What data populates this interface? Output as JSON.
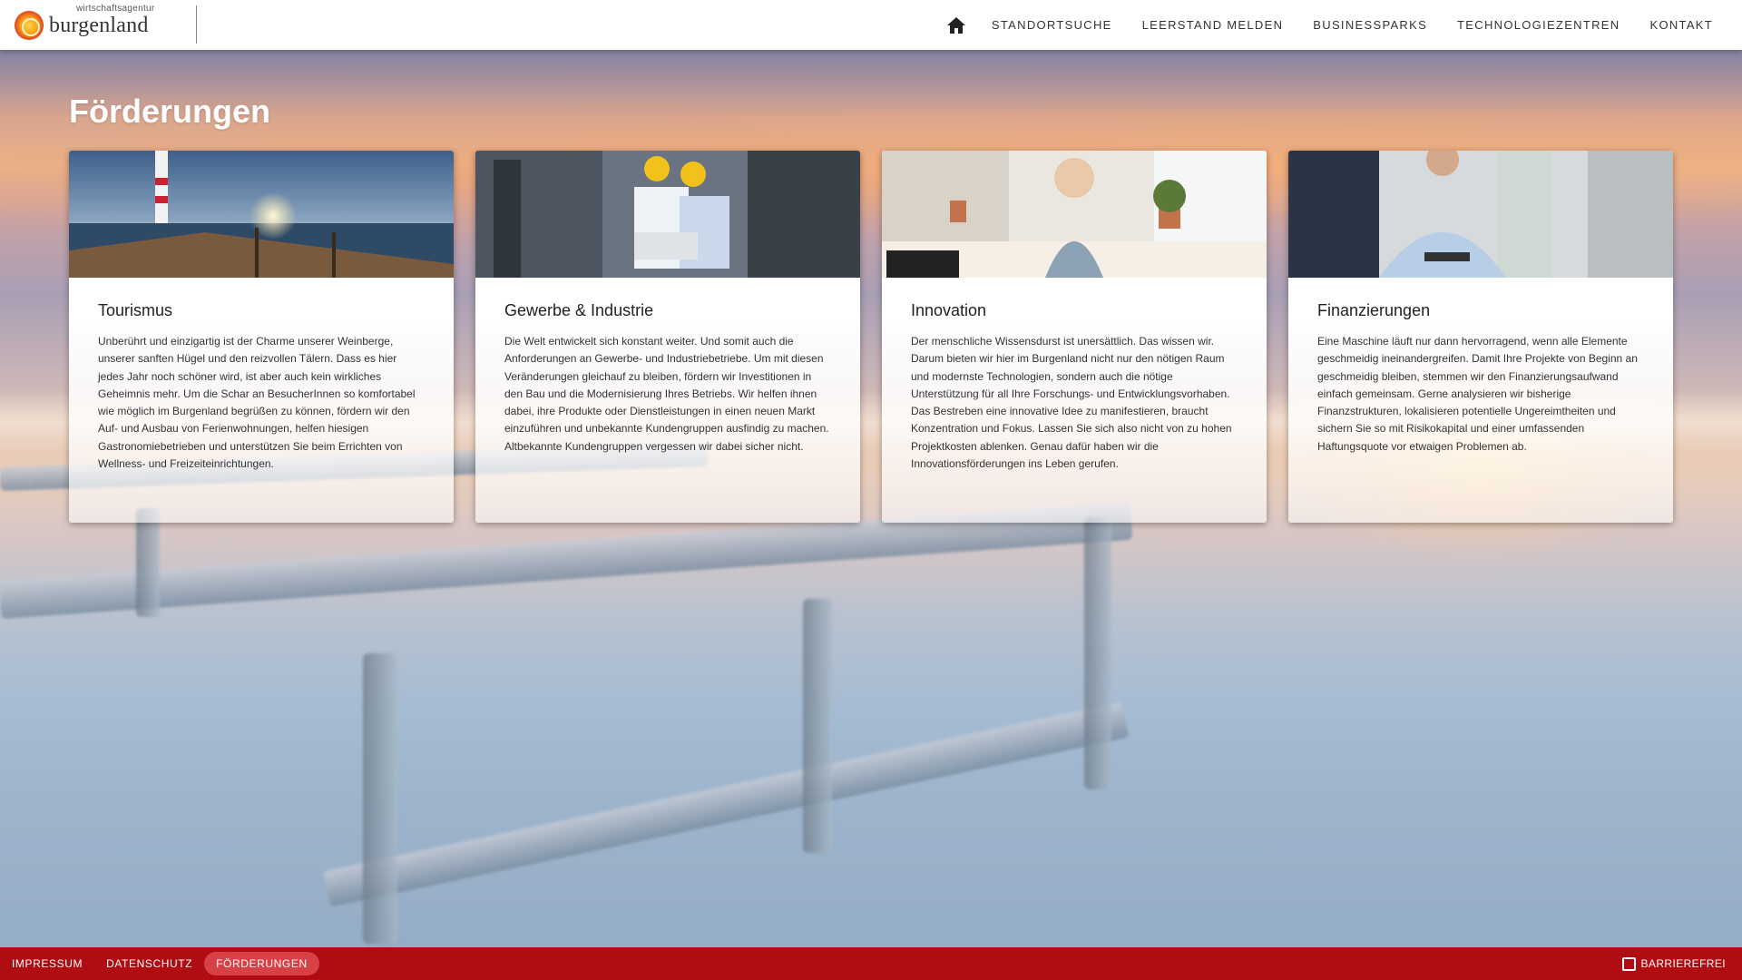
{
  "logo": {
    "small_text": "wirtschaftsagentur",
    "big_text": "burgenland"
  },
  "nav": {
    "home_icon": "home-icon",
    "items": [
      "STANDORTSUCHE",
      "LEERSTAND MELDEN",
      "BUSINESSPARKS",
      "TECHNOLOGIEZENTREN",
      "KONTAKT"
    ]
  },
  "page": {
    "title": "Förderungen"
  },
  "cards": [
    {
      "title": "Tourismus",
      "text": "Unberührt und einzigartig ist der Charme unserer Weinberge, unserer sanften Hügel und den reizvollen Tälern. Dass es hier jedes Jahr noch schöner wird, ist aber auch kein wirkliches Geheimnis mehr. Um die Schar an BesucherInnen so komfortabel wie möglich im Burgenland begrüßen zu können, fördern wir den Auf- und Ausbau von Ferienwohnungen, helfen hiesigen Gastronomiebetrieben und unterstützen Sie beim Errichten von Wellness- und Freizeiteinrichtungen."
    },
    {
      "title": "Gewerbe & Industrie",
      "text": "Die Welt entwickelt sich konstant weiter. Und somit auch die Anforderungen an Gewerbe- und Industriebetriebe. Um mit diesen Veränderungen gleichauf zu bleiben, fördern wir Investitionen in den Bau und die Modernisierung Ihres Betriebs. Wir helfen ihnen dabei, ihre Produkte oder Dienstleistungen in einen neuen Markt einzuführen und unbekannte Kundengruppen ausfindig zu machen. Altbekannte Kundengruppen vergessen wir dabei sicher nicht."
    },
    {
      "title": "Innovation",
      "text": "Der menschliche Wissensdurst ist unersättlich. Das wissen wir. Darum bieten wir hier im Burgenland nicht nur den nötigen Raum und modernste Technologien, sondern auch die nötige Unterstützung für all Ihre Forschungs- und Entwicklungsvorhaben. Das Bestreben eine innovative Idee zu manifestieren, braucht Konzentration und Fokus. Lassen Sie sich also nicht von zu hohen Projektkosten ablenken. Genau dafür haben wir die Innovationsförderungen ins Leben gerufen."
    },
    {
      "title": "Finanzierungen",
      "text": "Eine Maschine läuft nur dann hervorragend, wenn alle Elemente geschmeidig ineinandergreifen. Damit Ihre Projekte von Beginn an geschmeidig bleiben, stemmen wir den Finanzierungsaufwand einfach gemeinsam. Gerne analysieren wir bisherige Finanzstrukturen, lokalisieren potentielle Ungereimtheiten und sichern Sie so mit Risikokapital und einer umfassenden Haftungsquote vor etwaigen Problemen ab."
    }
  ],
  "footer": {
    "links": [
      "IMPRESSUM",
      "DATENSCHUTZ",
      "FÖRDERUNGEN"
    ],
    "active_link": "FÖRDERUNGEN",
    "accessibility_label": "BARRIEREFREI",
    "accessibility_checked": false
  },
  "colors": {
    "footer_bg": "#b00d12",
    "footer_active": "#d74044",
    "header_bg": "#ffffff"
  }
}
